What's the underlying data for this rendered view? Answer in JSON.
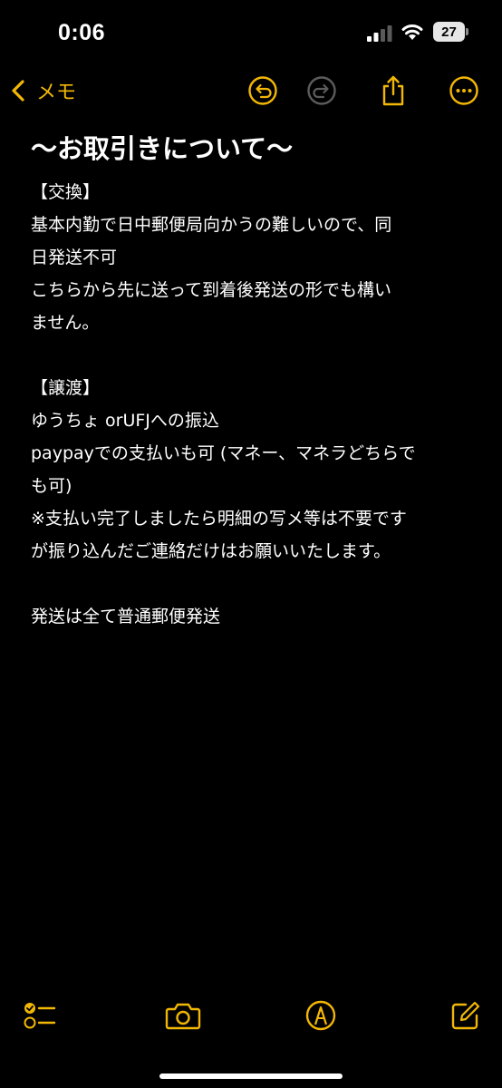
{
  "status_bar": {
    "time": "0:06",
    "battery_level": "27"
  },
  "nav": {
    "back_label": "メモ",
    "accent_color": "#f2b705"
  },
  "note": {
    "title": "〜お取引きについて〜",
    "lines": [
      "【交換】",
      "基本内勤で日中郵便局向かうの難しいので、同",
      "日発送不可",
      "こちらから先に送って到着後発送の形でも構い",
      "ません。",
      "",
      "【譲渡】",
      "ゆうちょ orUFJへの振込",
      "paypayでの支払いも可 (マネー、マネラどちらで",
      "も可)",
      "※支払い完了しましたら明細の写メ等は不要です",
      "が振り込んだご連絡だけはお願いいたします。",
      "",
      "発送は全て普通郵便発送"
    ]
  },
  "icons": {
    "nav": [
      "chevron-left-icon",
      "undo-icon",
      "redo-icon",
      "share-icon",
      "more-icon"
    ],
    "toolbar": [
      "checklist-icon",
      "camera-icon",
      "markup-pen-icon",
      "compose-icon"
    ]
  }
}
